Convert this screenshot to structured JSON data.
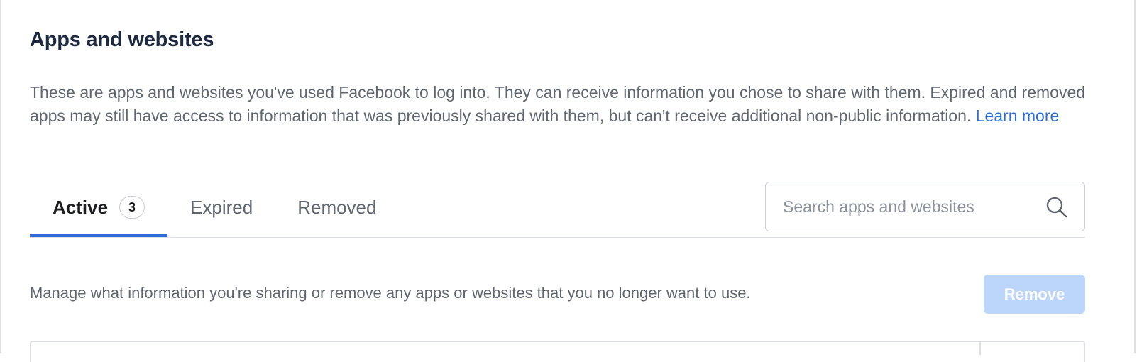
{
  "header": {
    "title": "Apps and websites"
  },
  "description": {
    "text": "These are apps and websites you've used Facebook to log into. They can receive information you chose to share with them. Expired and removed apps may still have access to information that was previously shared with them, but can't receive additional non-public information.",
    "learn_more": "Learn more"
  },
  "tabs": [
    {
      "label": "Active",
      "count": "3",
      "selected": true
    },
    {
      "label": "Expired",
      "selected": false
    },
    {
      "label": "Removed",
      "selected": false
    }
  ],
  "search": {
    "placeholder": "Search apps and websites",
    "value": "",
    "icon": "search-icon"
  },
  "manage": {
    "text": "Manage what information you're sharing or remove any apps or websites that you no longer want to use."
  },
  "actions": {
    "remove_label": "Remove",
    "remove_enabled": false
  },
  "colors": {
    "accent": "#2d6fd6",
    "title": "#1c2b41",
    "secondary_text": "#606770",
    "remove_disabled_bg": "#bcd6fb",
    "border": "#dddfe2"
  }
}
